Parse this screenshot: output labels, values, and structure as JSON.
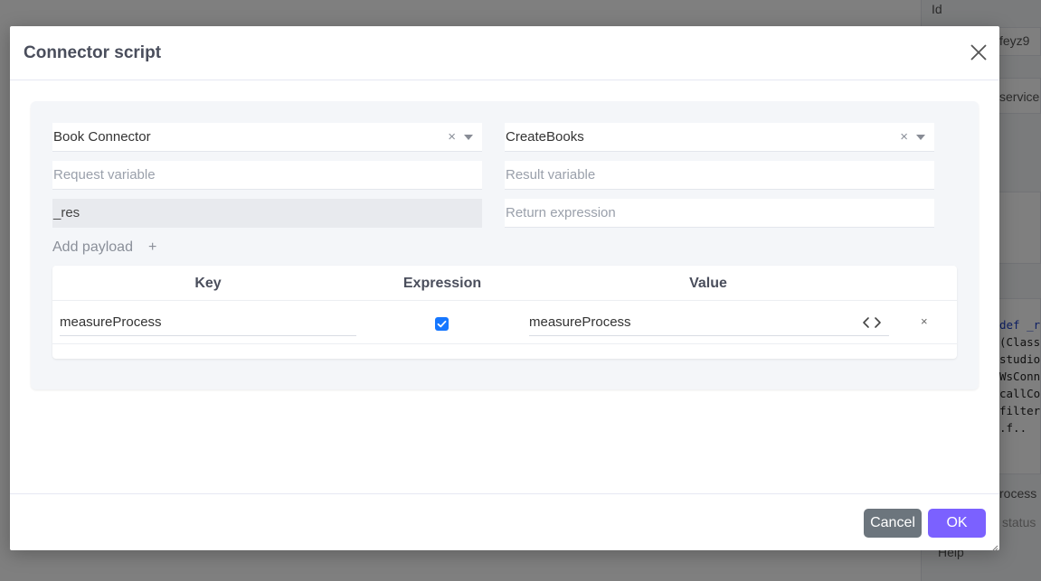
{
  "background": {
    "panel_rows": [
      "Id",
      "feyz9",
      "service",
      "rocess (",
      "status",
      "Help"
    ],
    "code_lines": [
      "def _r",
      "(Class",
      "studio",
      "WsConn",
      "callCo",
      "filter",
      ".f.."
    ]
  },
  "modal": {
    "title": "Connector script",
    "close_icon": "close-icon"
  },
  "form": {
    "connector": {
      "value": "Book Connector",
      "clear": "×"
    },
    "operation": {
      "value": "CreateBooks",
      "clear": "×"
    },
    "request_variable": {
      "placeholder": "Request variable",
      "value": ""
    },
    "result_variable": {
      "placeholder": "Result variable",
      "value": ""
    },
    "response_variable": {
      "value": "_res"
    },
    "return_expression": {
      "placeholder": "Return expression",
      "value": ""
    },
    "add_payload_label": "Add payload",
    "add_payload_icon": "+"
  },
  "payload_table": {
    "columns": [
      "Key",
      "Expression",
      "Value"
    ],
    "rows": [
      {
        "key": "measureProcess",
        "expression": true,
        "value": "measureProcess",
        "remove": "×"
      }
    ]
  },
  "footer": {
    "cancel_label": "Cancel",
    "ok_label": "OK"
  },
  "colors": {
    "ok": "#7b61ff",
    "cancel": "#6c757d",
    "checkbox": "#1677ff"
  }
}
